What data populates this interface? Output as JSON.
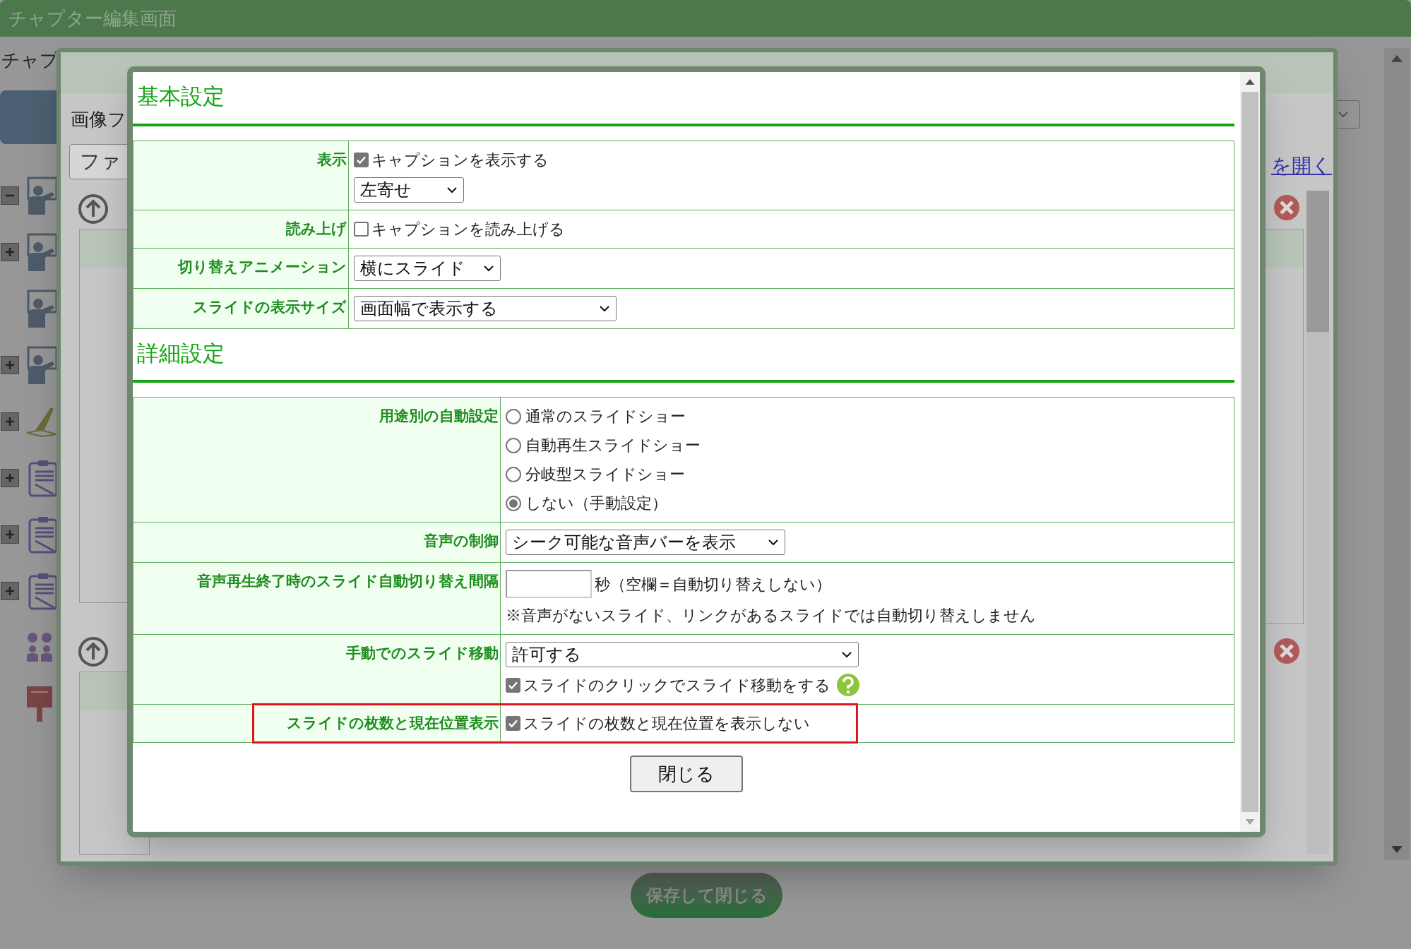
{
  "page": {
    "title": "チャプター編集画面",
    "label": "チャプ",
    "save_button": "保存して閉じる"
  },
  "tree": [
    {
      "kind": "presenter",
      "expanded": true
    },
    {
      "kind": "presenter",
      "expanded": false
    },
    {
      "kind": "presenter"
    },
    {
      "kind": "presenter",
      "expanded": false
    },
    {
      "kind": "sketch",
      "expanded": false
    },
    {
      "kind": "clipboard",
      "expanded": false
    },
    {
      "kind": "clipboard",
      "expanded": false
    },
    {
      "kind": "clipboard",
      "expanded": false
    },
    {
      "kind": "people"
    },
    {
      "kind": "postbox"
    }
  ],
  "editor": {
    "image_label": "画像フ",
    "file_button": "ファ",
    "open_link": "を開く"
  },
  "modal": {
    "sections": [
      {
        "title": "基本設定",
        "rows": [
          {
            "label": "表示",
            "highlighted": false,
            "controls": [
              {
                "kind": "checkbox",
                "label": "キャプションを表示する",
                "checked": true
              },
              {
                "kind": "select",
                "value": "左寄せ"
              }
            ]
          },
          {
            "label": "読み上げ",
            "highlighted": false,
            "controls": [
              {
                "kind": "checkbox",
                "label": "キャプションを読み上げる",
                "checked": false
              }
            ]
          },
          {
            "label": "切り替えアニメーション",
            "highlighted": false,
            "controls": [
              {
                "kind": "select",
                "value": "横にスライド"
              }
            ]
          },
          {
            "label": "スライドの表示サイズ",
            "highlighted": false,
            "controls": [
              {
                "kind": "select",
                "value": "画面幅で表示する"
              }
            ]
          }
        ]
      },
      {
        "title": "詳細設定",
        "rows": [
          {
            "label": "用途別の自動設定",
            "highlighted": false,
            "controls": [
              {
                "kind": "radio",
                "label": "通常のスライドショー",
                "selected": false
              },
              {
                "kind": "radio",
                "label": "自動再生スライドショー",
                "selected": false
              },
              {
                "kind": "radio",
                "label": "分岐型スライドショー",
                "selected": false
              },
              {
                "kind": "radio",
                "label": "しない（手動設定）",
                "selected": true
              }
            ]
          },
          {
            "label": "音声の制御",
            "highlighted": false,
            "controls": [
              {
                "kind": "select",
                "value": "シーク可能な音声バーを表示"
              }
            ]
          },
          {
            "label": "音声再生終了時のスライド自動切り替え間隔",
            "highlighted": false,
            "controls": [
              {
                "kind": "input",
                "suffix": "秒（空欄＝自動切り替えしない）"
              },
              {
                "kind": "note",
                "text": "※音声がないスライド、リンクがあるスライドでは自動切り替えしません"
              }
            ]
          },
          {
            "label": "手動でのスライド移動",
            "highlighted": false,
            "controls": [
              {
                "kind": "select",
                "value": "許可する"
              },
              {
                "kind": "checkbox",
                "label": "スライドのクリックでスライド移動をする",
                "checked": true,
                "help": true
              }
            ]
          },
          {
            "label": "スライドの枚数と現在位置表示",
            "highlighted": true,
            "controls": [
              {
                "kind": "checkbox",
                "label": "スライドの枚数と現在位置を表示しない",
                "checked": true
              }
            ]
          }
        ]
      }
    ],
    "close_button": "閉じる"
  }
}
